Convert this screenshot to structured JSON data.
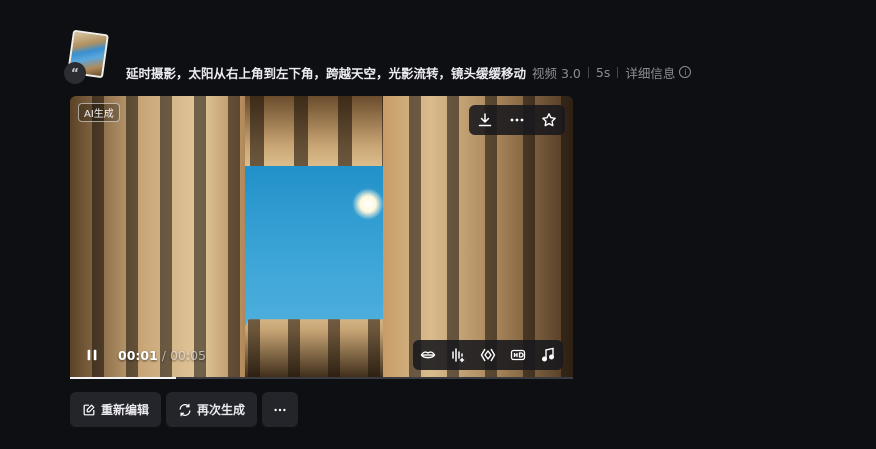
{
  "generation": {
    "prompt": "延时摄影，太阳从右上角到左下角，跨越天空，光影流转，镜头缓缓移动",
    "model": "视频 3.0",
    "duration": "5s",
    "details_link": "详细信息"
  },
  "player": {
    "ai_badge": "AI生成",
    "current_time": "00:01",
    "time_separator": " / ",
    "total_time": "00:05",
    "progress": 0.21
  },
  "top_tools": [
    "download-icon",
    "more-icon",
    "star-icon"
  ],
  "bottom_tools": [
    "lip-sync-icon",
    "audio-wave-icon",
    "frame-icon",
    "hd-icon",
    "music-icon"
  ],
  "actions": {
    "edit_label": "重新编辑",
    "regenerate_label": "再次生成"
  }
}
